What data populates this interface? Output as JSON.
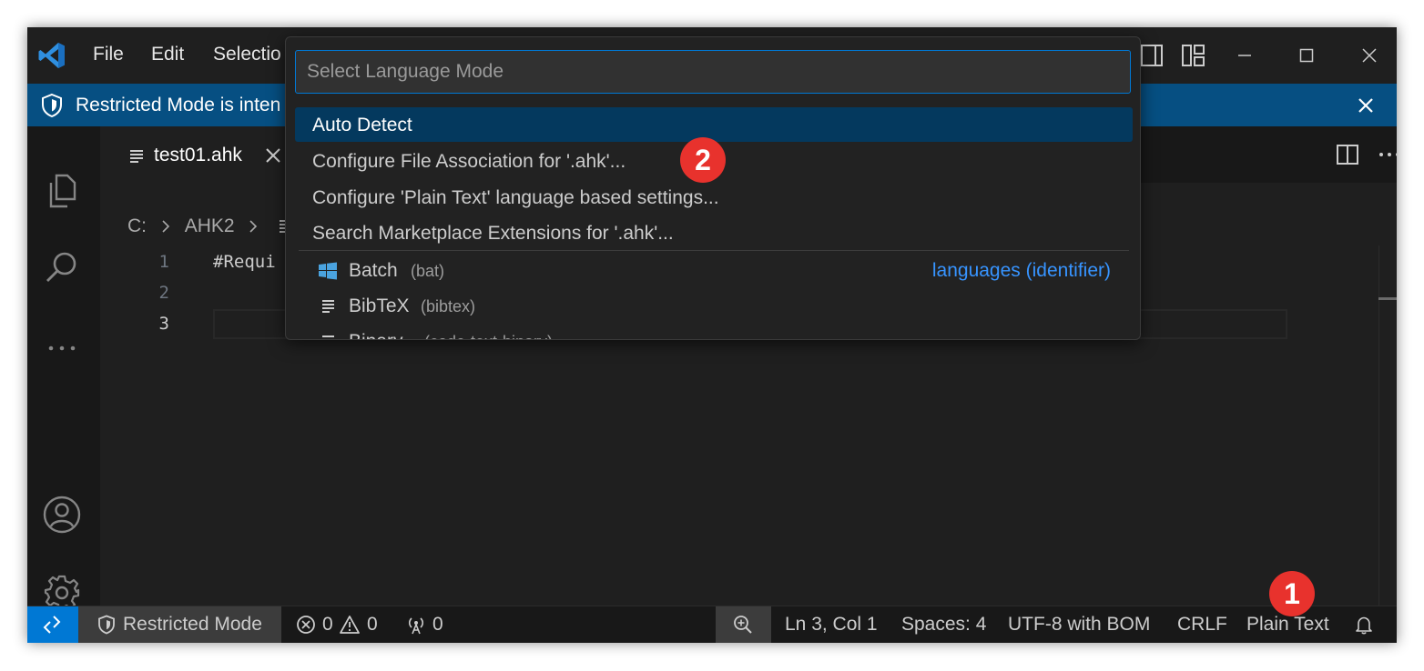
{
  "titlebar": {
    "menu": [
      "File",
      "Edit",
      "Selectio"
    ],
    "icons": [
      "vscode-logo-icon",
      "toggle-panel-icon",
      "customize-layout-icon",
      "minimize-icon",
      "maximize-icon",
      "close-icon"
    ]
  },
  "banner": {
    "text": "Restricted Mode is inten"
  },
  "tab": {
    "label": "test01.ahk"
  },
  "breadcrumb": [
    "C:",
    "AHK2"
  ],
  "editor": {
    "line_numbers": [
      "1",
      "2",
      "3"
    ],
    "lines": [
      "#Requi",
      "",
      ""
    ]
  },
  "quickpick": {
    "placeholder": "Select Language Mode",
    "actions": [
      {
        "label": "Auto Detect"
      },
      {
        "label": "Configure File Association for '.ahk'..."
      },
      {
        "label": "Configure 'Plain Text' language based settings..."
      },
      {
        "label": "Search Marketplace Extensions for '.ahk'..."
      }
    ],
    "languages": [
      {
        "name": "Batch",
        "id": "(bat)",
        "detail": "languages (identifier)",
        "icon": "windows-icon"
      },
      {
        "name": "BibTeX",
        "id": "(bibtex)",
        "detail": "",
        "icon": "text-file-icon"
      },
      {
        "name": "Binary",
        "id": "(code-text-binary)",
        "detail": "",
        "icon": "text-file-icon"
      }
    ]
  },
  "statusbar": {
    "restricted": "Restricted Mode",
    "errors": "0",
    "warnings": "0",
    "ports": "0",
    "position": "Ln 3, Col 1",
    "spaces": "Spaces: 4",
    "encoding": "UTF-8 with BOM",
    "eol": "CRLF",
    "language": "Plain Text"
  },
  "annotations": {
    "badge1": "1",
    "badge2": "2"
  },
  "colors": {
    "accent": "#0078d4",
    "banner": "#064f82",
    "selection": "#04395e",
    "badge": "#e8322d",
    "link": "#3794ff"
  }
}
